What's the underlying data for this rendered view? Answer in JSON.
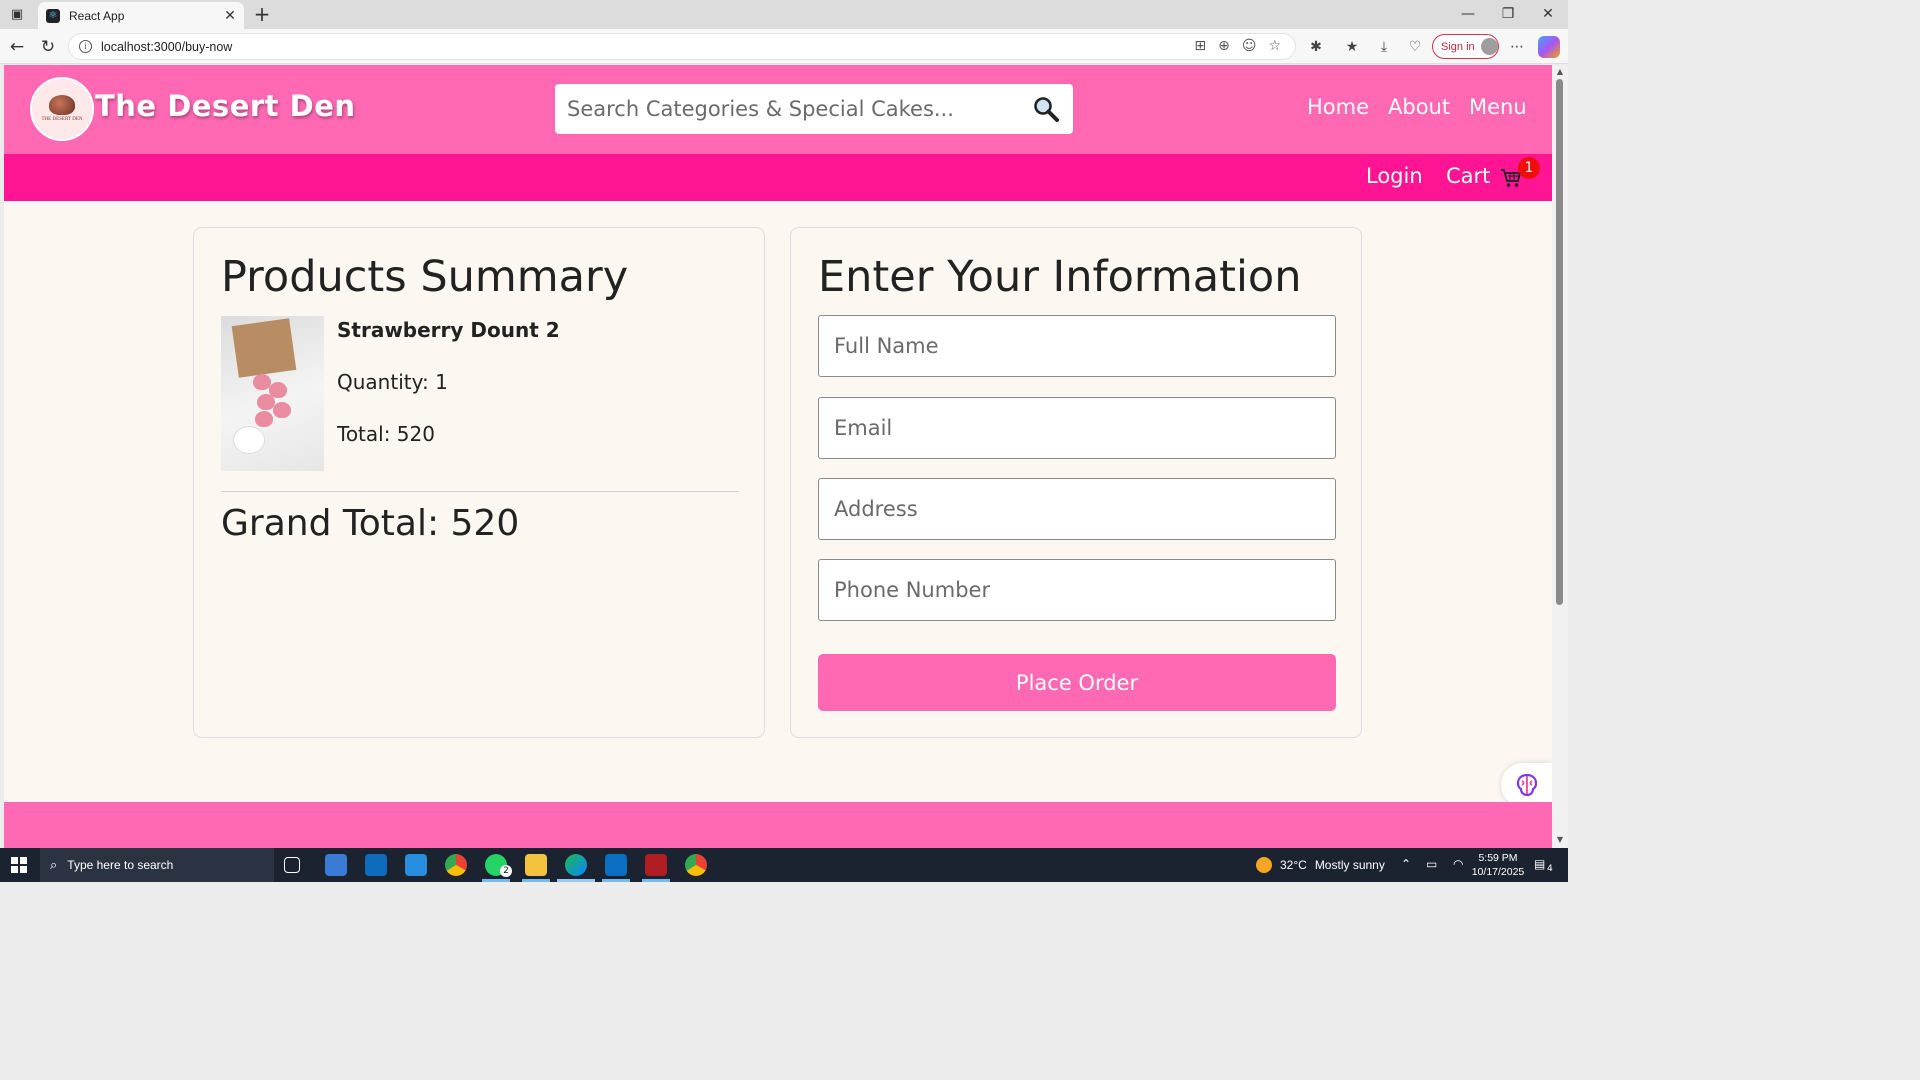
{
  "browser": {
    "tab_title": "React App",
    "url": "localhost:3000/buy-now",
    "signin_label": "Sign in"
  },
  "header": {
    "brand": "The Desert Den",
    "logo_text": "THE DESERT DEN",
    "search_placeholder": "Search Categories & Special Cakes...",
    "nav": [
      "Home",
      "About",
      "Menu"
    ]
  },
  "subnav": {
    "login": "Login",
    "cart": "Cart",
    "cart_count": "1"
  },
  "summary": {
    "title": "Products Summary",
    "product_name": "Strawberry Dount 2",
    "quantity": "Quantity: 1",
    "total": "Total: 520",
    "grand_total": "Grand Total: 520"
  },
  "form": {
    "title": "Enter Your Information",
    "full_name_placeholder": "Full Name",
    "email_placeholder": "Email",
    "address_placeholder": "Address",
    "phone_placeholder": "Phone Number",
    "submit_label": "Place Order"
  },
  "taskbar": {
    "search_placeholder": "Type here to search",
    "weather_temp": "32°C",
    "weather_text": "Mostly sunny",
    "time": "5:59 PM",
    "date": "10/17/2025",
    "whatsapp_badge": "2",
    "notification_count": "4"
  },
  "colors": {
    "header_pink": "#ff69b4",
    "subnav_pink": "#ff1493",
    "page_bg": "#fdf7f2",
    "badge_red": "#f20d0d"
  }
}
